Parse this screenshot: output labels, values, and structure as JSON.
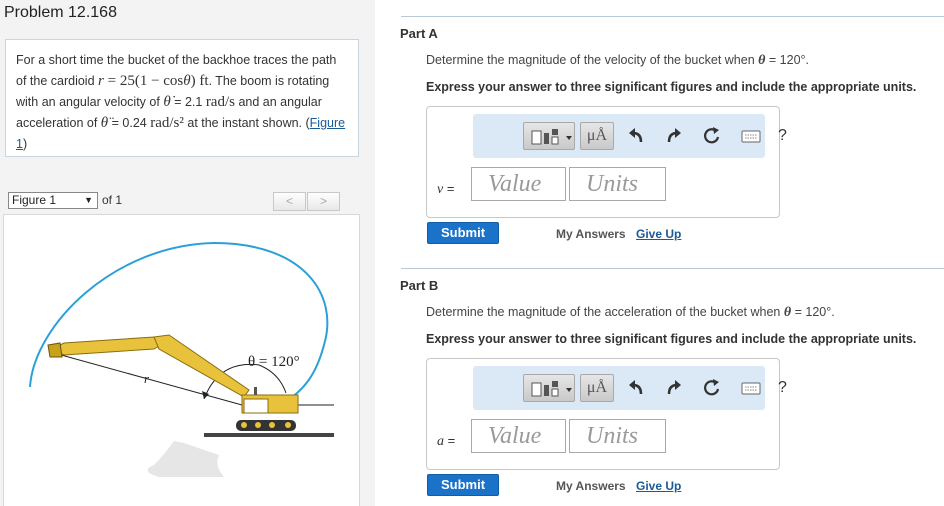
{
  "problem": {
    "title": "Problem 12.168",
    "text_1": "For a short time the bucket of the backhoe traces the path of the cardioid",
    "cardioid_r": "r",
    "cardioid_eq": " = 25(1 − cos",
    "cardioid_theta": "θ",
    "cardioid_end": ") ft",
    "text_2": ". The boom is rotating with an angular velocity of",
    "theta_dot": "θ̇",
    "omega_value": " = 2.1 ",
    "omega_units": "rad/s",
    "text_3": " and an angular acceleration of",
    "theta_ddot": "θ̈",
    "alpha_value": " = 0.24 ",
    "alpha_units": "rad/s²",
    "text_4": " at the instant shown. (",
    "figure_link": "Figure 1",
    "text_5": ")"
  },
  "figure_nav": {
    "selected": "Figure 1",
    "of_label": "of 1",
    "prev": "<",
    "next": ">"
  },
  "figure": {
    "angle_label": "θ = 120°",
    "r_label": "r"
  },
  "toolbar": {
    "units_label": "μÅ",
    "help_label": "?"
  },
  "parts": [
    {
      "title": "Part A",
      "question_prefix": "Determine the magnitude of the velocity of the bucket when",
      "theta_sym": "θ",
      "question_suffix": " = 120°.",
      "instruction": "Express your answer to three significant figures and include the appropriate units.",
      "var_symbol": "v",
      "var_eq": " =",
      "value_placeholder": "Value",
      "units_placeholder": "Units",
      "submit": "Submit",
      "my_answers": "My Answers",
      "give_up": "Give Up"
    },
    {
      "title": "Part B",
      "question_prefix": "Determine the magnitude of the acceleration of the bucket when",
      "theta_sym": "θ",
      "question_suffix": " = 120°.",
      "instruction": "Express your answer to three significant figures and include the appropriate units.",
      "var_symbol": "a",
      "var_eq": " =",
      "value_placeholder": "Value",
      "units_placeholder": "Units",
      "submit": "Submit",
      "my_answers": "My Answers",
      "give_up": "Give Up"
    }
  ],
  "colors": {
    "accent": "#1a73c8",
    "link": "#1a5a96",
    "toolbar_bg": "#dbe8f5",
    "cardioid": "#2a9fd8",
    "backhoe": "#e8c23a"
  }
}
